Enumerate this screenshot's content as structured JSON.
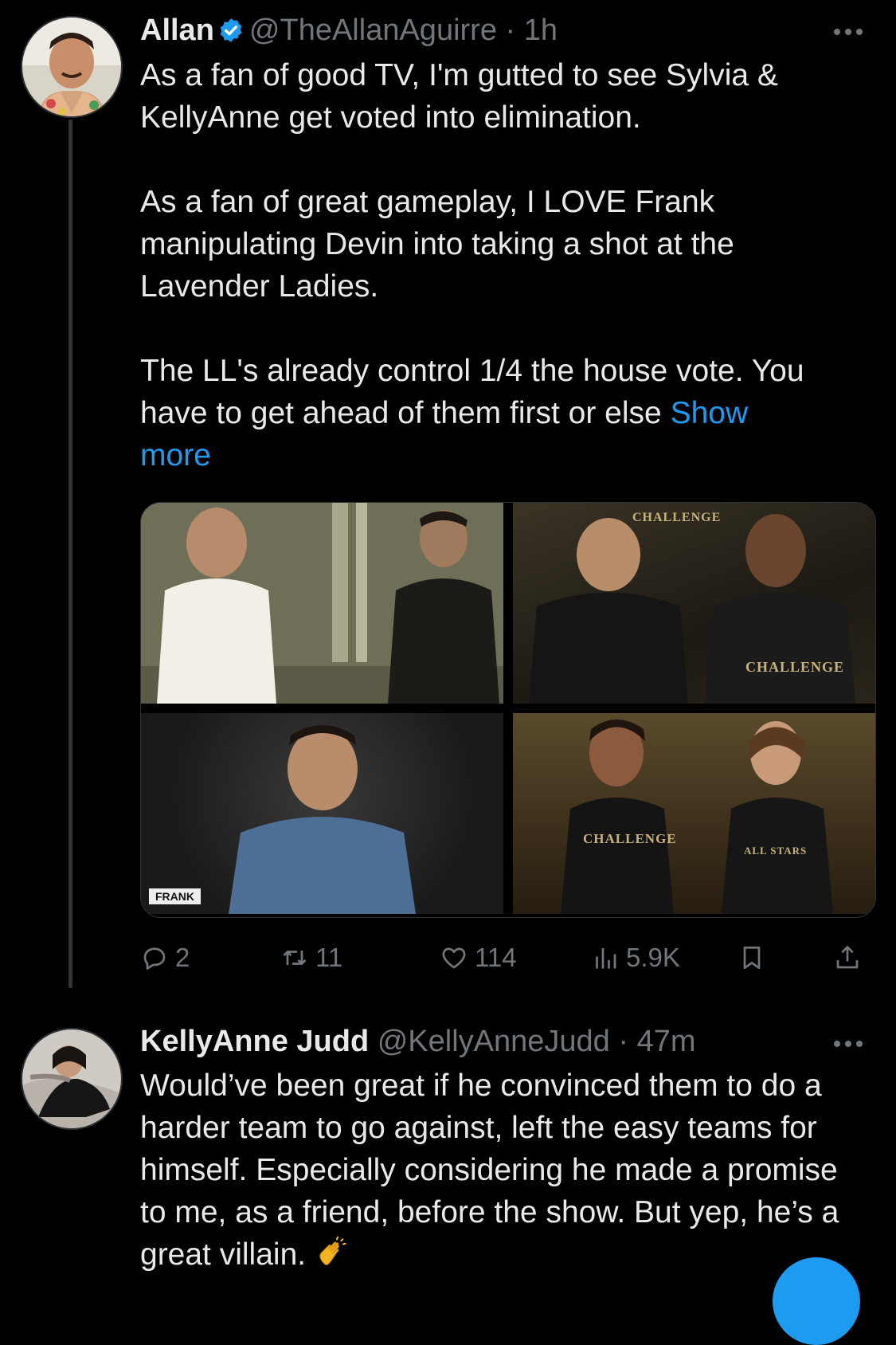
{
  "tweet1": {
    "name": "Allan",
    "handle": "@TheAllanAguirre",
    "time": "· 1h",
    "para1": "As a fan of good TV, I'm gutted to see Sylvia & KellyAnne get voted into elimination.",
    "para2": "As a fan of great gameplay, I LOVE Frank manipulating Devin into taking a shot at the Lavender Ladies.",
    "para3": "The LL's already control 1/4 the house vote. You have to get ahead of them first or else",
    "show_more": "Show more",
    "media_tag": "FRANK",
    "media_badges": [
      "CHALLENGE",
      "CHALLENGE",
      "ALL STARS"
    ],
    "metrics": {
      "replies": "2",
      "reposts": "11",
      "likes": "114",
      "views": "5.9K"
    }
  },
  "tweet2": {
    "name": "KellyAnne Judd",
    "handle": "@KellyAnneJudd",
    "time": "· 47m",
    "text": "Would’ve been great if he convinced them to do a harder team to go against, left the easy teams for himself. Especially considering he made a promise to me, as a friend, before the show. But yep, he’s a great villain.",
    "emoji": "clapping-hands"
  },
  "colors": {
    "background": "#000000",
    "text": "#e7e9ea",
    "muted": "#71767b",
    "accent": "#1d9bf0"
  }
}
